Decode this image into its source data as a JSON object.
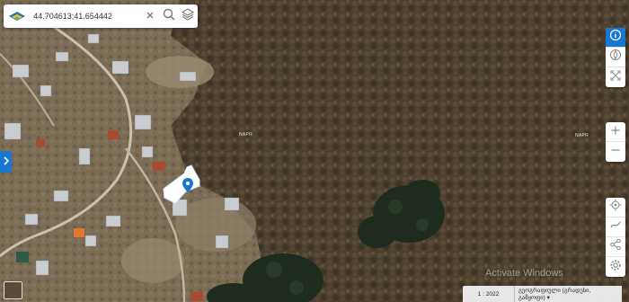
{
  "search": {
    "value": "44.704613;41.654442"
  },
  "icons": {
    "logo": "logo-icon",
    "clear": "close-icon",
    "search": "search-icon",
    "layers": "layers-icon",
    "info": "info-icon",
    "compass": "compass-icon",
    "fullscreen": "fullscreen-icon",
    "zoom_in": "plus-icon",
    "zoom_out": "minus-icon",
    "locate": "locate-icon",
    "draw": "draw-icon",
    "share": "share-icon",
    "settings": "gear-icon",
    "collapse": "chevron-right-icon"
  },
  "map_labels": [
    "NAPR",
    "NAPR"
  ],
  "watermark": "Activate Windows",
  "scale": {
    "label": "1 : 2022",
    "projection": "გეოგრაფიული (გრადუსი, გამყოფი) ▾"
  },
  "colors": {
    "accent": "#1976d2",
    "parcel": "#ffffff"
  }
}
